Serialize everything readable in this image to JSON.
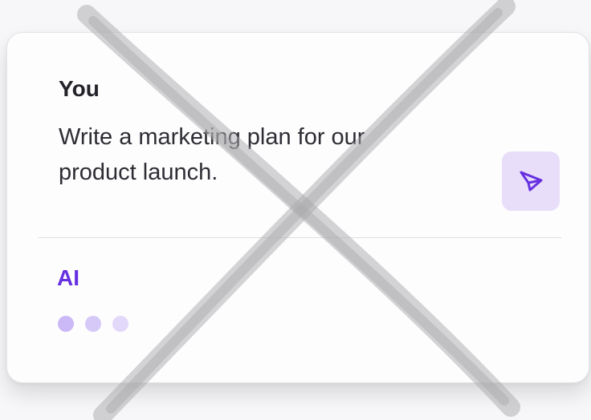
{
  "chat": {
    "user_label": "You",
    "user_message": "Write a marketing plan for our product launch.",
    "ai_label": "AI",
    "send_icon": "paper-plane-icon",
    "typing_indicator_dots": 3
  },
  "overlay": {
    "type": "crossed-out",
    "icon": "x-mark"
  },
  "colors": {
    "accent": "#6630e0",
    "send_button_bg": "#e8def9",
    "dot_colors": [
      "#cab9f6",
      "#d6c9f8",
      "#e2d9fa"
    ],
    "cross_stroke": "#a9a9ab"
  }
}
